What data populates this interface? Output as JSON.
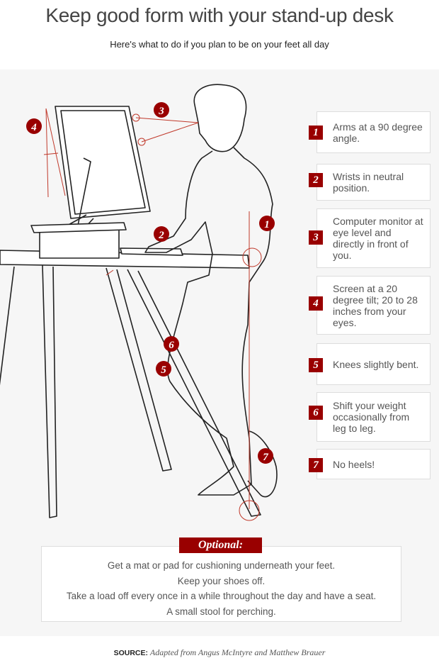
{
  "header": {
    "title": "Keep good form with your stand-up desk",
    "subtitle": "Here's what to do if you plan to be on your feet all day"
  },
  "colors": {
    "accent": "#990000",
    "panel": "#f6f6f6"
  },
  "tips": [
    {
      "num": "1",
      "text": "Arms at a 90 degree angle."
    },
    {
      "num": "2",
      "text": "Wrists in neutral position."
    },
    {
      "num": "3",
      "text": "Computer monitor at eye level and directly in front of you."
    },
    {
      "num": "4",
      "text": "Screen at a 20 degree tilt; 20 to 28 inches from your eyes."
    },
    {
      "num": "5",
      "text": "Knees slightly bent."
    },
    {
      "num": "6",
      "text": "Shift your weight occasionally from leg to leg."
    },
    {
      "num": "7",
      "text": "No heels!"
    }
  ],
  "optional": {
    "label": "Optional:",
    "items": [
      "Get a mat or pad for cushioning underneath your feet.",
      "Keep your shoes off.",
      "Take a load off every once in a while throughout the day and have a seat.",
      "A small stool for perching."
    ]
  },
  "source": {
    "label": "SOURCE:",
    "text": "Adapted from Angus McIntyre and Matthew Brauer"
  }
}
